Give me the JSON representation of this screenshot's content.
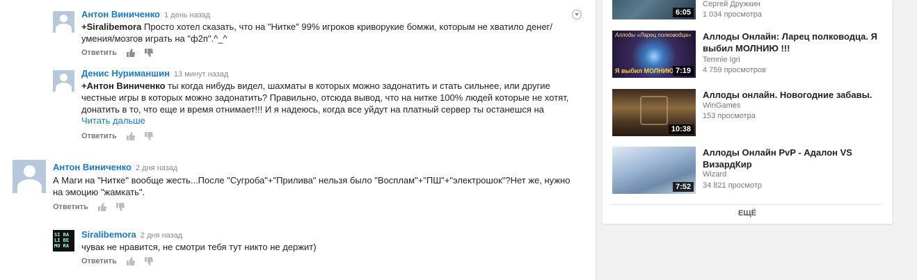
{
  "comments": [
    {
      "author": "Антон Виниченко",
      "time": "1 день назад",
      "mention": "+Siralibemora",
      "text": " Просто хотел сказать, что на \"Нитке\" 99% игроков криворукие бомжи, которым не хватило денег/",
      "text2": "умения/мозгов играть на \"ф2п\".^_^",
      "reply": "Ответить"
    },
    {
      "author": "Денис Нуриманшин",
      "time": "13 минут назад",
      "mention": "+Антон Виниченко",
      "text": "  ты когда нибудь видел, шахматы в которых можно задонатить и стать сильнее, или другие",
      "text2": "честные игры в которых можно задонатить? Правильно, отсюда вывод, что на нитке 100% людей которые не хотят,",
      "text3": "донатить в то, что еще и время отнимает!!! И я надеюсь, когда все уйдут на платный сервер ты останешся на",
      "more": "Читать дальше",
      "reply": "Ответить"
    },
    {
      "author": "Антон Виниченко",
      "time": "2 дня назад",
      "text": "А Маги на \"Нитке\" вообще жесть...После \"Сугроба\"+\"Прилива\" нельзя было \"Восплам\"+\"ПШ\"+\"электрошок\"?Нет же, нужно",
      "text2": "на эмоцию \"жамкать\".",
      "reply": "Ответить"
    },
    {
      "author": "Siralibemora",
      "time": "2 дня назад",
      "text": "чувак не нравится, не смотри тебя тут никто не держит)",
      "reply": "Ответить",
      "avatar_text": "SI RA LI BE MO RA"
    }
  ],
  "sidebar": {
    "videos": [
      {
        "title": "",
        "channel": "Сергей Дружкин",
        "views": "1 034 просмотра",
        "duration": "6:05",
        "thumb_color": "#3d5a6e"
      },
      {
        "title": "Аллоды Онлайн: Ларец полководца. Я выбил МОЛНИЮ !!!",
        "channel": "Temnie Igri",
        "views": "4 759 просмотров",
        "duration": "7:19",
        "thumb_color": "#4a3b6b",
        "thumb_caption_top": "Аллоды «Ларец полководца»",
        "thumb_caption_bottom": "Я выбил МОЛНИЮ"
      },
      {
        "title": "Аллоды онлайн. Новогодние забавы.",
        "channel": "WinGames",
        "views": "153 просмотра",
        "duration": "10:38",
        "thumb_color": "#6a4a2a"
      },
      {
        "title": "Аллоды Онлайн PvP - Адалон VS ВизардКир",
        "channel": "Wizard",
        "views": "34 821 просмотр",
        "duration": "7:52",
        "thumb_color": "#8aa8c4"
      }
    ],
    "more_label": "ЕЩЁ"
  }
}
